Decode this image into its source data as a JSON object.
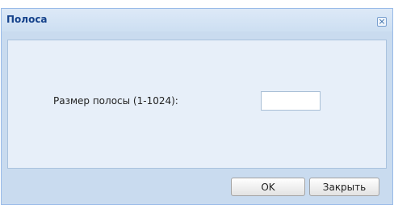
{
  "dialog": {
    "title": "Полоса",
    "close_icon": "close-icon",
    "field_label": "Размер полосы (1-1024):",
    "field_value": "",
    "ok_label": "OK",
    "close_label": "Закрыть"
  },
  "colors": {
    "title_text": "#15428b",
    "dialog_bg": "#c9dbef",
    "content_bg": "#e7eff9",
    "border": "#99bbe8"
  }
}
